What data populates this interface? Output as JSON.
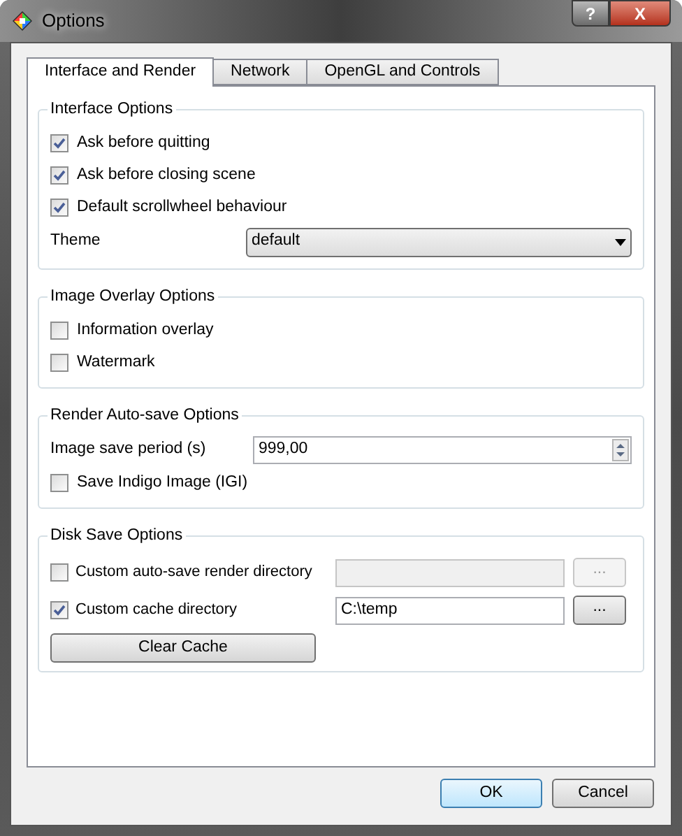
{
  "window": {
    "title": "Options",
    "help_button": "?",
    "close_button": "X"
  },
  "tabs": [
    {
      "label": "Interface and Render",
      "selected": true
    },
    {
      "label": "Network",
      "selected": false
    },
    {
      "label": "OpenGL and Controls",
      "selected": false
    }
  ],
  "groups": [
    {
      "title": "Interface Options",
      "rows": [
        {
          "kind": "checkbox",
          "label": "Ask before quitting",
          "checked": true
        },
        {
          "kind": "checkbox",
          "label": "Ask before closing scene",
          "checked": true
        },
        {
          "kind": "checkbox",
          "label": "Default scrollwheel behaviour",
          "checked": true
        },
        {
          "kind": "select",
          "label": "Theme",
          "value": "default"
        }
      ]
    },
    {
      "title": "Image Overlay Options",
      "rows": [
        {
          "kind": "checkbox",
          "label": "Information overlay",
          "checked": false
        },
        {
          "kind": "checkbox",
          "label": "Watermark",
          "checked": false
        }
      ]
    },
    {
      "title": "Render Auto-save Options",
      "rows": [
        {
          "kind": "spin",
          "label": "Image save period (s)",
          "value": "999,00"
        },
        {
          "kind": "checkbox",
          "label": "Save Indigo Image (IGI)",
          "checked": false
        }
      ]
    },
    {
      "title": "Disk Save Options",
      "rows": [
        {
          "kind": "dir",
          "label": "Custom auto-save render directory",
          "checked": false,
          "disabled": true,
          "browse": "..."
        },
        {
          "kind": "dir",
          "label": "Custom cache directory",
          "checked": true,
          "disabled": false,
          "value": "C:\\temp",
          "browse": "..."
        },
        {
          "kind": "button",
          "label": "Clear Cache"
        }
      ]
    }
  ],
  "buttons": [
    {
      "label": "OK",
      "default": true
    },
    {
      "label": "Cancel",
      "default": false
    }
  ]
}
